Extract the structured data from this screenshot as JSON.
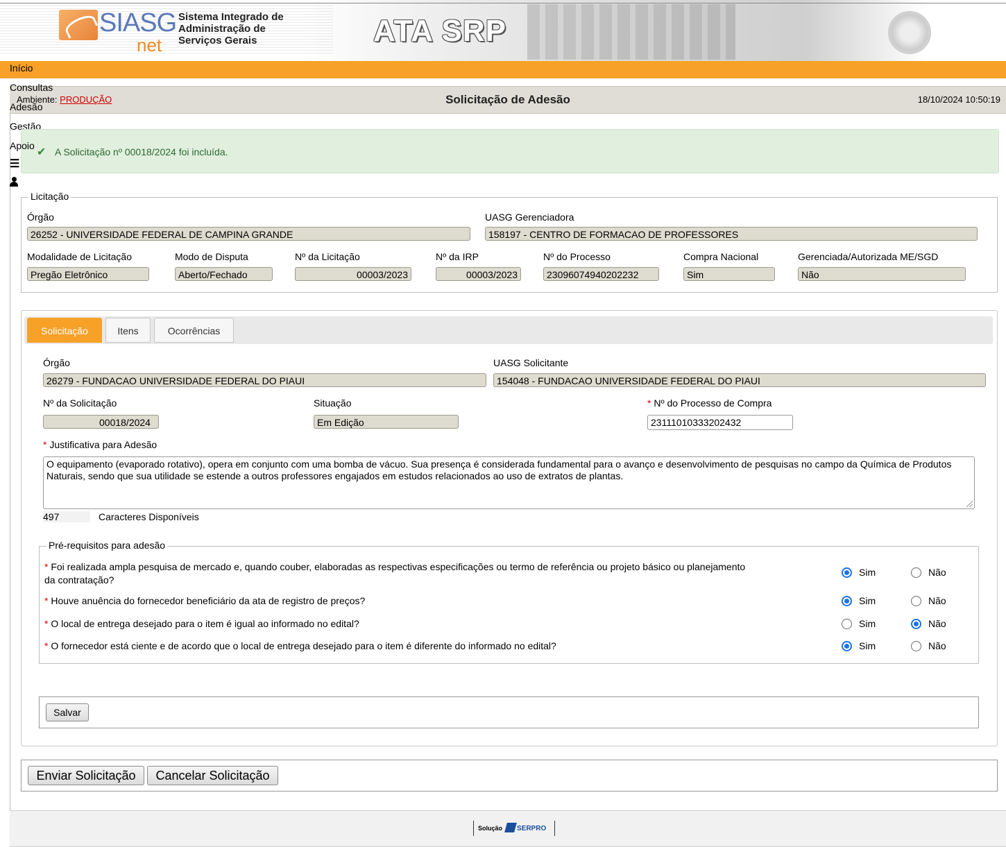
{
  "header": {
    "logo_text": "SIASG",
    "logo_sub": "net",
    "system_name_lines": [
      "Sistema Integrado de",
      "Administração de",
      "Serviços Gerais"
    ],
    "module_title": "ATA SRP"
  },
  "menu": [
    "Início",
    "Consultas",
    "Adesão",
    "Gestão",
    "Apoio"
  ],
  "titlebar": {
    "ambiente_label": "Ambiente:",
    "ambiente_value": "PRODUÇÃO",
    "page_title": "Solicitação de Adesão",
    "datetime": "18/10/2024 10:50:19"
  },
  "alert": {
    "message": "A Solicitação nº 00018/2024 foi incluída."
  },
  "licitacao": {
    "legend": "Licitação",
    "orgao_label": "Órgão",
    "orgao_value": "26252 - UNIVERSIDADE FEDERAL DE CAMPINA GRANDE",
    "uasg_label": "UASG Gerenciadora",
    "uasg_value": "158197 - CENTRO DE FORMACAO DE PROFESSORES",
    "modalidade_label": "Modalidade de Licitação",
    "modalidade_value": "Pregão Eletrônico",
    "modo_label": "Modo de Disputa",
    "modo_value": "Aberto/Fechado",
    "num_licitacao_label": "Nº da Licitação",
    "num_licitacao_value": "00003/2023",
    "num_irp_label": "Nº da IRP",
    "num_irp_value": "00003/2023",
    "num_processo_label": "Nº do Processo",
    "num_processo_value": "23096074940202232",
    "compra_nacional_label": "Compra Nacional",
    "compra_nacional_value": "Sim",
    "gerenciada_label": "Gerenciada/Autorizada ME/SGD",
    "gerenciada_value": "Não"
  },
  "tabs": [
    "Solicitação",
    "Itens",
    "Ocorrências"
  ],
  "solicitacao": {
    "orgao_label": "Órgão",
    "orgao_value": "26279 - FUNDACAO UNIVERSIDADE FEDERAL DO PIAUI",
    "uasg_label": "UASG Solicitante",
    "uasg_value": "154048 - FUNDACAO UNIVERSIDADE FEDERAL DO PIAUI",
    "num_solicitacao_label": "Nº da Solicitação",
    "num_solicitacao_value": "00018/2024",
    "situacao_label": "Situação",
    "situacao_value": "Em Edição",
    "processo_compra_label": "Nº do Processo de Compra",
    "processo_compra_value": "23111010333202432",
    "justificativa_label": "Justificativa para Adesão",
    "justificativa_value": "O equipamento (evaporado rotativo), opera em conjunto com uma bomba de vácuo. Sua presença é considerada fundamental para o avanço e desenvolvimento de pesquisas no campo da Química de Produtos Naturais, sendo que sua utilidade se estende a outros professores engajados em estudos relacionados ao uso de extratos de plantas.",
    "caracteres_count": "497",
    "caracteres_label": "Caracteres Disponíveis"
  },
  "prerequisitos": {
    "legend": "Pré-requisitos para adesão",
    "sim_label": "Sim",
    "nao_label": "Não",
    "questions": [
      {
        "line1": "Foi realizada ampla pesquisa de mercado e, quando couber, elaboradas as respectivas especificações ou termo de referência ou projeto básico ou planejamento",
        "line2": "da contratação?",
        "answer": "Sim"
      },
      {
        "line1": "Houve anuência do fornecedor beneficiário da ata de registro de preços?",
        "line2": "",
        "answer": "Sim"
      },
      {
        "line1": "O local de entrega desejado para o item é igual ao informado no edital?",
        "line2": "",
        "answer": "Não"
      },
      {
        "line1": "O fornecedor está ciente e de acordo que o local de entrega desejado para o item é diferente do informado no edital?",
        "line2": "",
        "answer": "Sim"
      }
    ]
  },
  "buttons": {
    "salvar": "Salvar",
    "enviar": "Enviar Solicitação",
    "cancelar": "Cancelar Solicitação"
  },
  "footer": {
    "solucao": "Solução",
    "serpro": "SERPRO"
  },
  "colors": {
    "accent": "#f7a128",
    "success_bg": "#e1efdf",
    "radio_on": "#1a73e8",
    "required": "#dd0000"
  }
}
